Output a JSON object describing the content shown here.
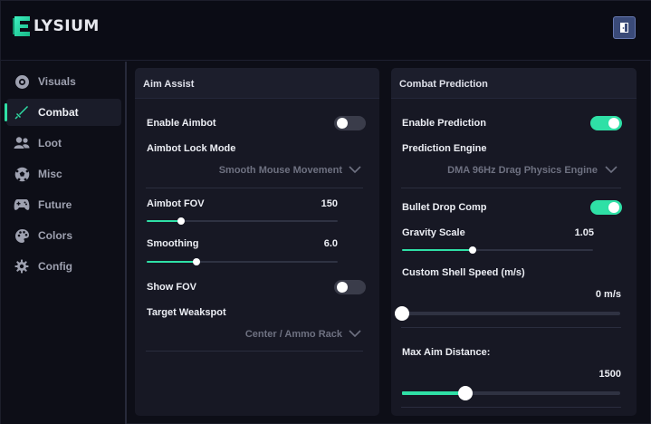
{
  "app": {
    "logo_letter": "E",
    "logo_text": "LYSIUM",
    "accent": "#2fe0a6"
  },
  "header": {
    "exit_icon": "door-exit-icon"
  },
  "sidebar": {
    "items": [
      {
        "label": "Visuals",
        "icon": "eye-circle-icon",
        "active": false
      },
      {
        "label": "Combat",
        "icon": "sword-icon",
        "active": true
      },
      {
        "label": "Loot",
        "icon": "users-icon",
        "active": false
      },
      {
        "label": "Misc",
        "icon": "soccer-ball-icon",
        "active": false
      },
      {
        "label": "Future",
        "icon": "gamepad-icon",
        "active": false
      },
      {
        "label": "Colors",
        "icon": "palette-icon",
        "active": false
      },
      {
        "label": "Config",
        "icon": "gear-icon",
        "active": false
      }
    ]
  },
  "aim_assist": {
    "title": "Aim Assist",
    "enable_aimbot": {
      "label": "Enable Aimbot",
      "on": false
    },
    "lock_mode": {
      "label": "Aimbot Lock Mode",
      "value": "Smooth Mouse Movement"
    },
    "fov": {
      "label": "Aimbot FOV",
      "value": "150",
      "fraction": 0.18
    },
    "smoothing": {
      "label": "Smoothing",
      "value": "6.0",
      "fraction": 0.26
    },
    "show_fov": {
      "label": "Show FOV",
      "on": false
    },
    "weakspot": {
      "label": "Target Weakspot",
      "value": "Center / Ammo Rack"
    }
  },
  "combat_prediction": {
    "title": "Combat Prediction",
    "enable_prediction": {
      "label": "Enable Prediction",
      "on": true
    },
    "engine": {
      "label": "Prediction Engine",
      "value": "DMA 96Hz Drag Physics Engine"
    },
    "bullet_drop": {
      "label": "Bullet Drop Comp",
      "on": true
    },
    "gravity": {
      "label": "Gravity Scale",
      "value": "1.05",
      "fraction": 0.37
    },
    "shell_speed": {
      "label": "Custom Shell Speed (m/s)",
      "value": "0 m/s",
      "fraction": 0.0
    },
    "max_distance": {
      "label": "Max Aim Distance:",
      "value": "1500",
      "fraction": 0.29
    }
  }
}
